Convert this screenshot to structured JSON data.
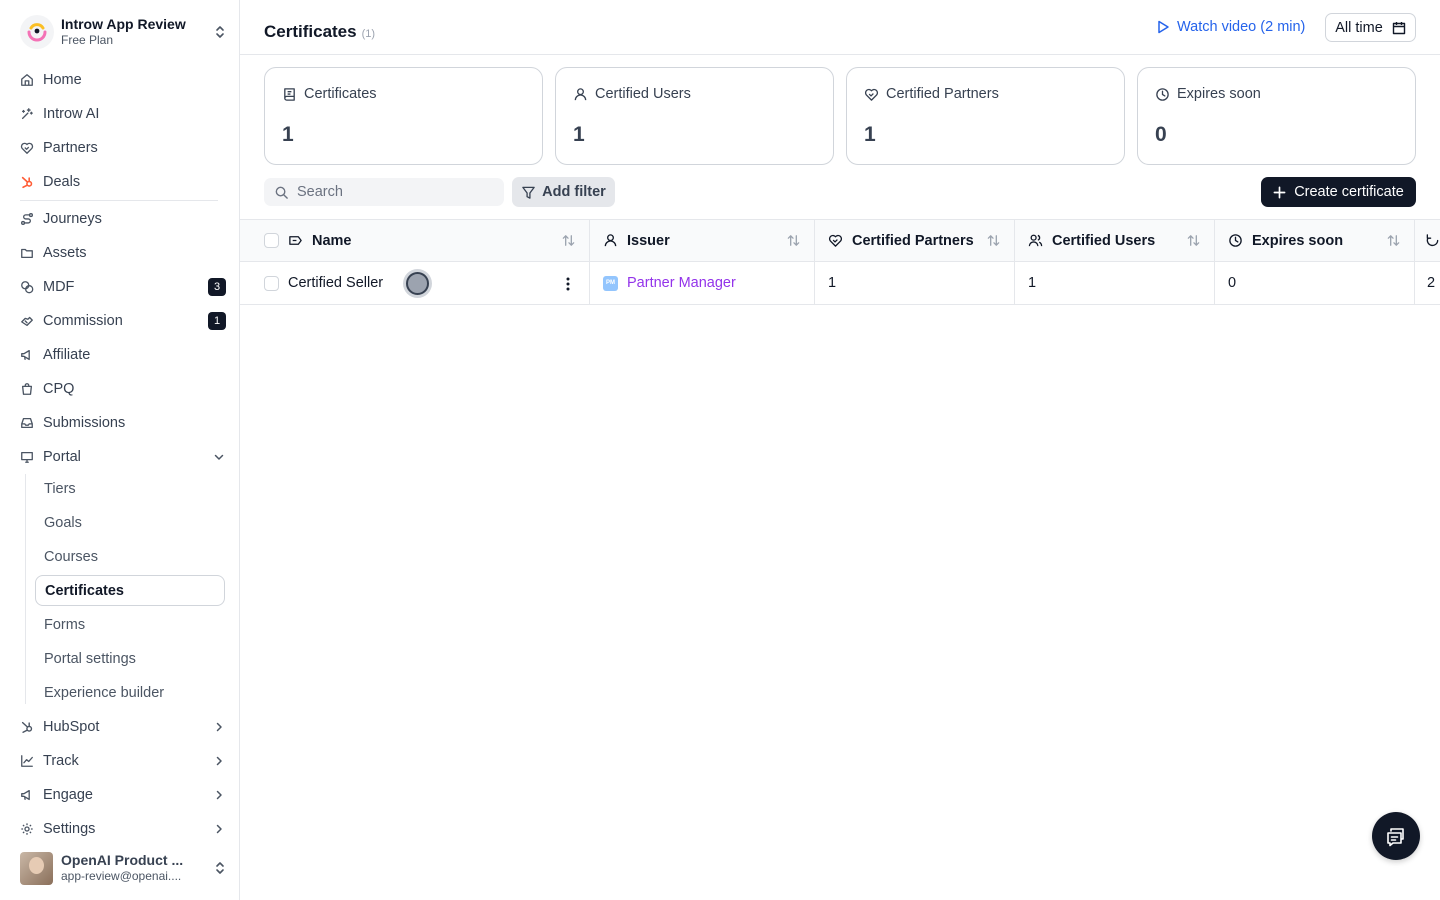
{
  "workspace": {
    "name": "Introw App Review",
    "plan": "Free Plan"
  },
  "nav": {
    "home": "Home",
    "ai": "Introw AI",
    "partners": "Partners",
    "deals": "Deals",
    "journeys": "Journeys",
    "assets": "Assets",
    "mdf": "MDF",
    "mdf_badge": "3",
    "commission": "Commission",
    "commission_badge": "1",
    "affiliate": "Affiliate",
    "cpq": "CPQ",
    "submissions": "Submissions",
    "portal": "Portal",
    "portal_sub": [
      "Tiers",
      "Goals",
      "Courses",
      "Certificates",
      "Forms",
      "Portal settings",
      "Experience builder"
    ],
    "hubspot": "HubSpot",
    "track": "Track",
    "engage": "Engage",
    "settings": "Settings"
  },
  "user": {
    "name": "OpenAI Product ...",
    "email": "app-review@openai...."
  },
  "header": {
    "title": "Certificates",
    "count": "(1)",
    "watch_video": "Watch video (2 min)",
    "date_range": "All time"
  },
  "stats": [
    {
      "label": "Certificates",
      "value": "1",
      "icon": "certificate-icon"
    },
    {
      "label": "Certified Users",
      "value": "1",
      "icon": "user-icon"
    },
    {
      "label": "Certified Partners",
      "value": "1",
      "icon": "handshake-heart-icon"
    },
    {
      "label": "Expires soon",
      "value": "0",
      "icon": "clock-icon"
    }
  ],
  "toolbar": {
    "search_placeholder": "Search",
    "add_filter": "Add filter",
    "create": "Create certificate"
  },
  "table": {
    "columns": [
      "Name",
      "Issuer",
      "Certified Partners",
      "Certified Users",
      "Expires soon"
    ],
    "rows": [
      {
        "name": "Certified Seller",
        "issuer": "Partner Manager",
        "issuer_tag": "PM",
        "certified_partners": "1",
        "certified_users": "1",
        "expires_soon": "0",
        "extra": "2"
      }
    ]
  },
  "colors": {
    "accent": "#111827",
    "link": "#9333ea",
    "watch": "#2563eb",
    "hubspot": "#ff5c35"
  }
}
